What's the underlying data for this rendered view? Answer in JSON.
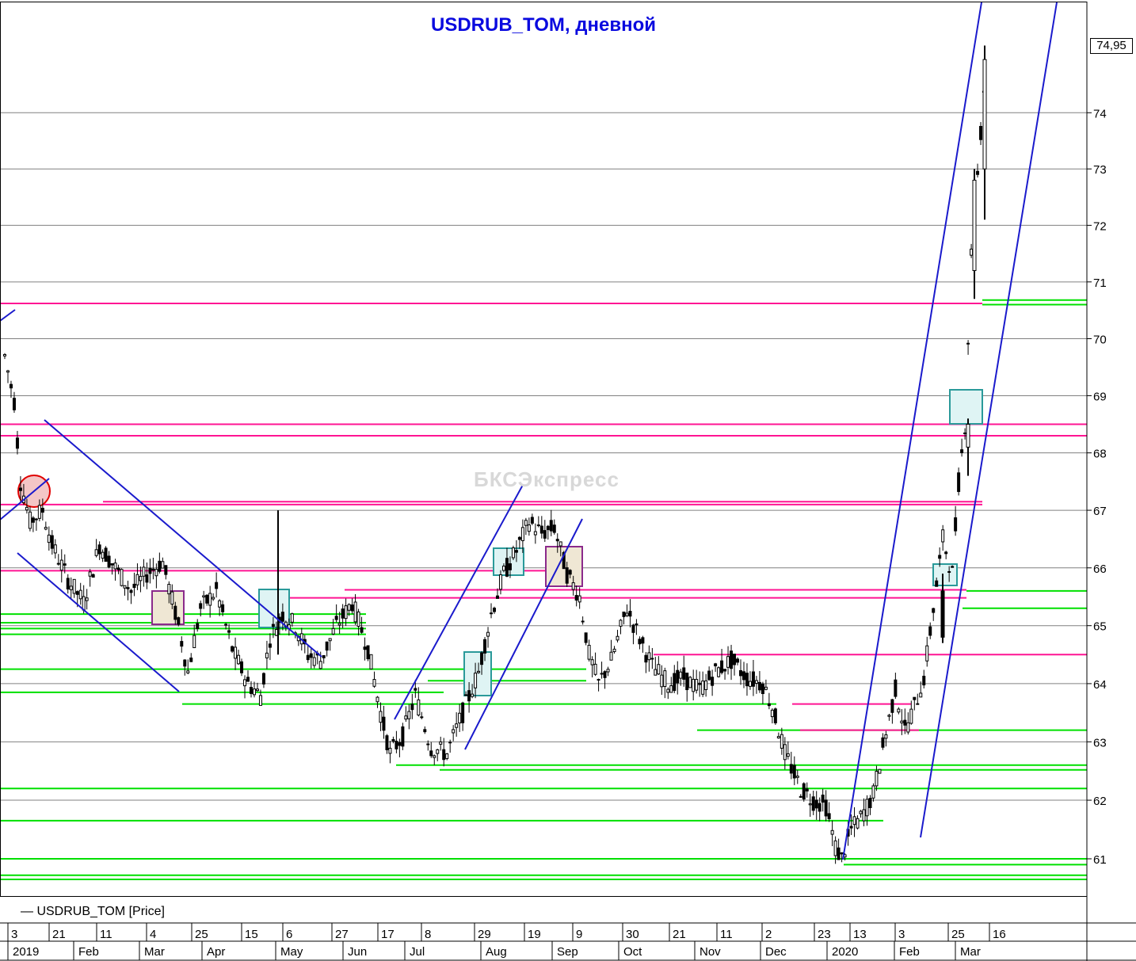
{
  "title": "USDRUB_TOM, дневной",
  "legend": "— USDRUB_TOM [Price]",
  "watermark": "БКСЭкспресс",
  "current_price": "74,95",
  "colors": {
    "title": "#0a0adf",
    "candle": "#000000",
    "trendline": "#1a1acc",
    "support": "#00e000",
    "resistance": "#ff1493",
    "box_cyan": "#2a9a9a",
    "box_purple": "#8b2a8b",
    "fill_cyan": "#dff4f4",
    "fill_beige": "#efe7d4",
    "circle": "#e00000"
  },
  "chart_data": {
    "type": "candlestick",
    "title": "USDRUB_TOM, дневной",
    "series_name": "USDRUB_TOM [Price]",
    "ylim": [
      60.5,
      75.7
    ],
    "y_ticks": [
      61,
      62,
      63,
      64,
      65,
      66,
      67,
      68,
      69,
      70,
      71,
      72,
      73,
      74
    ],
    "x_day_labels": [
      "3",
      "21",
      "11",
      "4",
      "25",
      "15",
      "6",
      "27",
      "17",
      "8",
      "29",
      "19",
      "9",
      "30",
      "21",
      "11",
      "2",
      "23",
      "13",
      "3",
      "25",
      "16"
    ],
    "x_month_labels": [
      "2019",
      "Feb",
      "Mar",
      "Apr",
      "May",
      "Jun",
      "Jul",
      "Aug",
      "Sep",
      "Oct",
      "Nov",
      "Dec",
      "2020",
      "Feb",
      "Mar"
    ],
    "close_path": [
      [
        0,
        69.7
      ],
      [
        3,
        68.9
      ],
      [
        5,
        67.5
      ],
      [
        8,
        66.8
      ],
      [
        12,
        67.0
      ],
      [
        15,
        66.4
      ],
      [
        20,
        65.8
      ],
      [
        25,
        65.4
      ],
      [
        30,
        66.4
      ],
      [
        35,
        66.0
      ],
      [
        40,
        65.6
      ],
      [
        45,
        65.9
      ],
      [
        50,
        66.1
      ],
      [
        55,
        65.0
      ],
      [
        58,
        64.2
      ],
      [
        62,
        65.3
      ],
      [
        67,
        65.6
      ],
      [
        72,
        64.6
      ],
      [
        77,
        64.0
      ],
      [
        81,
        63.8
      ],
      [
        84,
        64.8
      ],
      [
        88,
        65.2
      ],
      [
        92,
        65.0
      ],
      [
        96,
        64.5
      ],
      [
        100,
        64.4
      ],
      [
        105,
        65.0
      ],
      [
        110,
        65.4
      ],
      [
        115,
        64.6
      ],
      [
        119,
        63.5
      ],
      [
        122,
        62.8
      ],
      [
        126,
        63.1
      ],
      [
        130,
        63.8
      ],
      [
        135,
        62.9
      ],
      [
        140,
        62.8
      ],
      [
        145,
        63.5
      ],
      [
        150,
        64.2
      ],
      [
        154,
        65.2
      ],
      [
        158,
        65.9
      ],
      [
        162,
        66.3
      ],
      [
        166,
        66.8
      ],
      [
        170,
        66.6
      ],
      [
        174,
        66.7
      ],
      [
        178,
        65.9
      ],
      [
        182,
        65.5
      ],
      [
        185,
        64.5
      ],
      [
        188,
        64.0
      ],
      [
        192,
        64.4
      ],
      [
        197,
        65.3
      ],
      [
        200,
        64.9
      ],
      [
        205,
        64.3
      ],
      [
        210,
        64.0
      ],
      [
        215,
        64.1
      ],
      [
        220,
        63.9
      ],
      [
        225,
        64.2
      ],
      [
        230,
        64.4
      ],
      [
        235,
        64.1
      ],
      [
        240,
        64.0
      ],
      [
        243,
        63.6
      ],
      [
        247,
        62.8
      ],
      [
        252,
        62.2
      ],
      [
        256,
        62.0
      ],
      [
        260,
        61.9
      ],
      [
        263,
        61.2
      ],
      [
        265,
        61.0
      ],
      [
        268,
        61.5
      ],
      [
        271,
        61.7
      ],
      [
        275,
        62.1
      ],
      [
        278,
        62.9
      ],
      [
        282,
        63.9
      ],
      [
        285,
        63.2
      ],
      [
        288,
        63.6
      ],
      [
        291,
        64.1
      ],
      [
        294,
        65.3
      ],
      [
        297,
        66.5
      ],
      [
        300,
        65.9
      ],
      [
        302,
        67.5
      ],
      [
        304,
        68.5
      ],
      [
        306,
        71.5
      ],
      [
        308,
        72.9
      ],
      [
        310,
        74.4
      ],
      [
        311,
        73.8
      ]
    ],
    "candles": [
      {
        "o": 61.3,
        "h": 61.6,
        "l": 60.9,
        "c": 61.1
      },
      {
        "o": 61.1,
        "h": 61.4,
        "l": 60.95,
        "c": 61.3
      },
      {
        "o": 65.6,
        "h": 65.9,
        "l": 64.7,
        "c": 64.8
      },
      {
        "o": 68.1,
        "h": 68.6,
        "l": 67.6,
        "c": 68.5
      },
      {
        "o": 71.2,
        "h": 73.0,
        "l": 70.7,
        "c": 72.8
      },
      {
        "o": 73.0,
        "h": 75.2,
        "l": 72.1,
        "c": 74.95
      }
    ],
    "support_levels": [
      70.68,
      70.6,
      68.5,
      68.3,
      65.6,
      65.3,
      65.2,
      65.05,
      64.95,
      64.85,
      64.25,
      64.05,
      63.85,
      63.65,
      63.2,
      62.6,
      62.52,
      62.2,
      61.65,
      61.0,
      60.9,
      60.72,
      60.65
    ],
    "resistance_levels": [
      70.62,
      68.5,
      68.3,
      67.15,
      67.1,
      65.95,
      65.62,
      65.48,
      64.5,
      63.65,
      63.2
    ],
    "trend_channels": [
      {
        "name": "descending channel early 2019"
      },
      {
        "name": "ascending channel mid 2019"
      },
      {
        "name": "ascending channel early 2020"
      }
    ]
  }
}
